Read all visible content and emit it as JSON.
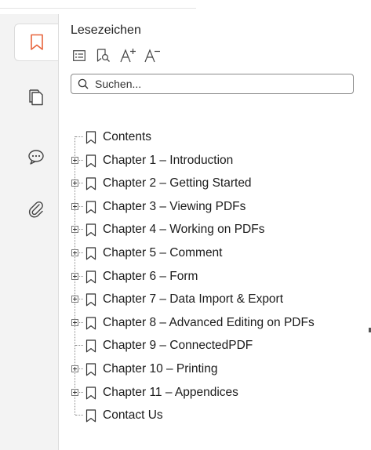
{
  "panel": {
    "title": "Lesezeichen",
    "search_placeholder": "Suchen..."
  },
  "toolbar": {
    "buttons": [
      "list-options-icon",
      "find-bookmark-icon",
      "increase-font-icon",
      "decrease-font-icon"
    ]
  },
  "sidebar_tabs": [
    "bookmarks-icon",
    "pages-icon",
    "comments-icon",
    "attachments-icon"
  ],
  "bookmarks": [
    {
      "label": "Contents",
      "expandable": false
    },
    {
      "label": "Chapter 1 – Introduction",
      "expandable": true
    },
    {
      "label": "Chapter 2 – Getting Started",
      "expandable": true
    },
    {
      "label": "Chapter 3 – Viewing PDFs",
      "expandable": true
    },
    {
      "label": "Chapter 4 – Working on PDFs",
      "expandable": true
    },
    {
      "label": "Chapter 5 – Comment",
      "expandable": true
    },
    {
      "label": "Chapter 6 – Form",
      "expandable": true
    },
    {
      "label": "Chapter 7 – Data Import & Export",
      "expandable": true
    },
    {
      "label": "Chapter 8 – Advanced Editing on PDFs",
      "expandable": true
    },
    {
      "label": "Chapter 9 – ConnectedPDF",
      "expandable": false
    },
    {
      "label": "Chapter 10 – Printing",
      "expandable": true
    },
    {
      "label": "Chapter 11 – Appendices",
      "expandable": true
    },
    {
      "label": "Contact Us",
      "expandable": false
    }
  ],
  "colors": {
    "accent": "#e8643c",
    "icon": "#444444"
  }
}
